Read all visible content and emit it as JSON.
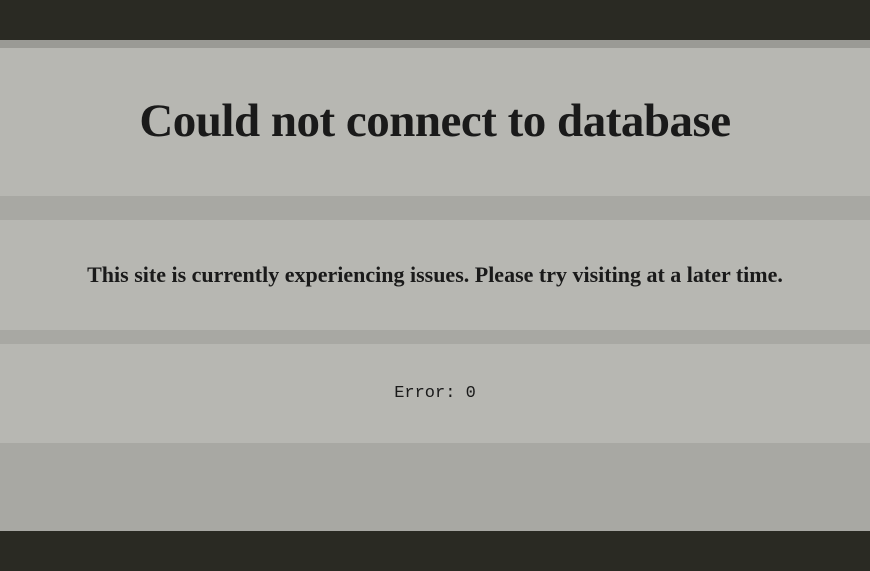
{
  "error": {
    "title": "Could not connect to database",
    "message": "This site is currently experiencing issues. Please try visiting at a later time.",
    "code_label": "Error: 0"
  }
}
